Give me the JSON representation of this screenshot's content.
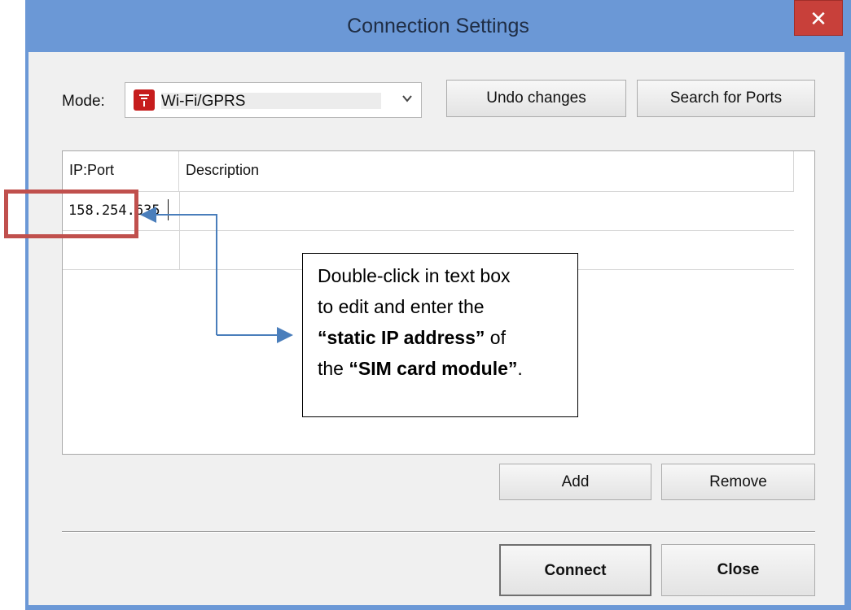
{
  "window": {
    "title": "Connection Settings",
    "close_glyph": "✕",
    "accent": "#6b98d6",
    "close_color": "#c8403a"
  },
  "mode": {
    "label": "Mode:",
    "selected": "Wi-Fi/GPRS",
    "icon": "wifi-gprs-icon",
    "chevron": "v"
  },
  "toolbar": {
    "undo_label": "Undo changes",
    "search_label": "Search for Ports"
  },
  "table": {
    "columns": [
      "IP:Port",
      "Description"
    ],
    "rows": [
      {
        "ip": "158.254.635",
        "description": ""
      },
      {
        "ip": "",
        "description": ""
      }
    ]
  },
  "list_buttons": {
    "add_label": "Add",
    "remove_label": "Remove"
  },
  "footer": {
    "connect_label": "Connect",
    "close_label": "Close"
  },
  "annotation": {
    "line1": "Double-click in text box",
    "line2": "to edit and enter the",
    "bold1": "“static IP address”",
    "after_bold1": " of",
    "line4_prefix": "the ",
    "bold2": "“SIM card module”",
    "line4_suffix": ".",
    "highlight_color": "#c0504d",
    "arrow_color": "#4a7ebb"
  }
}
